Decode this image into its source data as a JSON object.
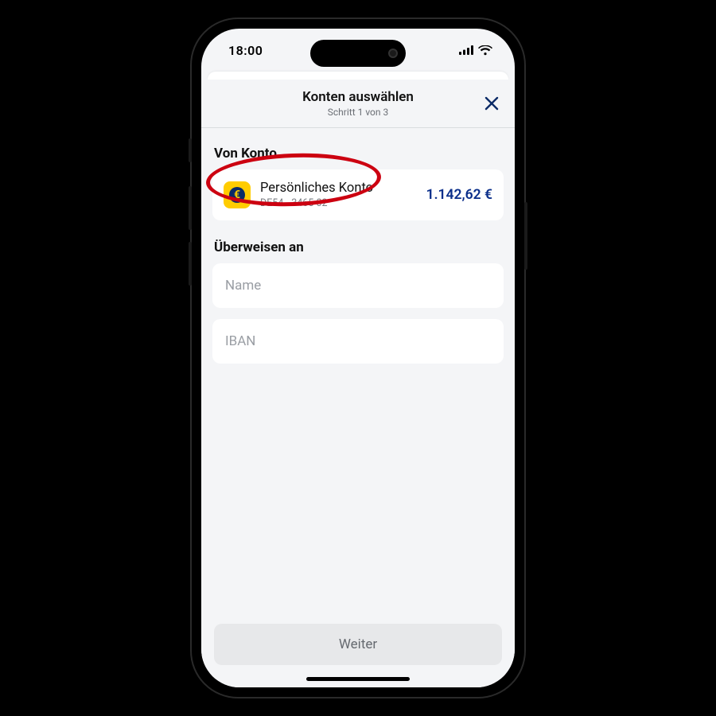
{
  "status": {
    "time": "18:00"
  },
  "header": {
    "title": "Konten auswählen",
    "subtitle": "Schritt 1 von 3"
  },
  "from": {
    "label": "Von Konto",
    "account": {
      "name": "Persönliches Konto",
      "iban_masked": "DE54...3465 02",
      "balance": "1.142,62 €",
      "icon_glyph": "€"
    }
  },
  "to": {
    "label": "Überweisen an",
    "name_placeholder": "Name",
    "iban_placeholder": "IBAN"
  },
  "footer": {
    "continue_label": "Weiter"
  },
  "annotation": {
    "highlight_target": "from-account-card"
  }
}
